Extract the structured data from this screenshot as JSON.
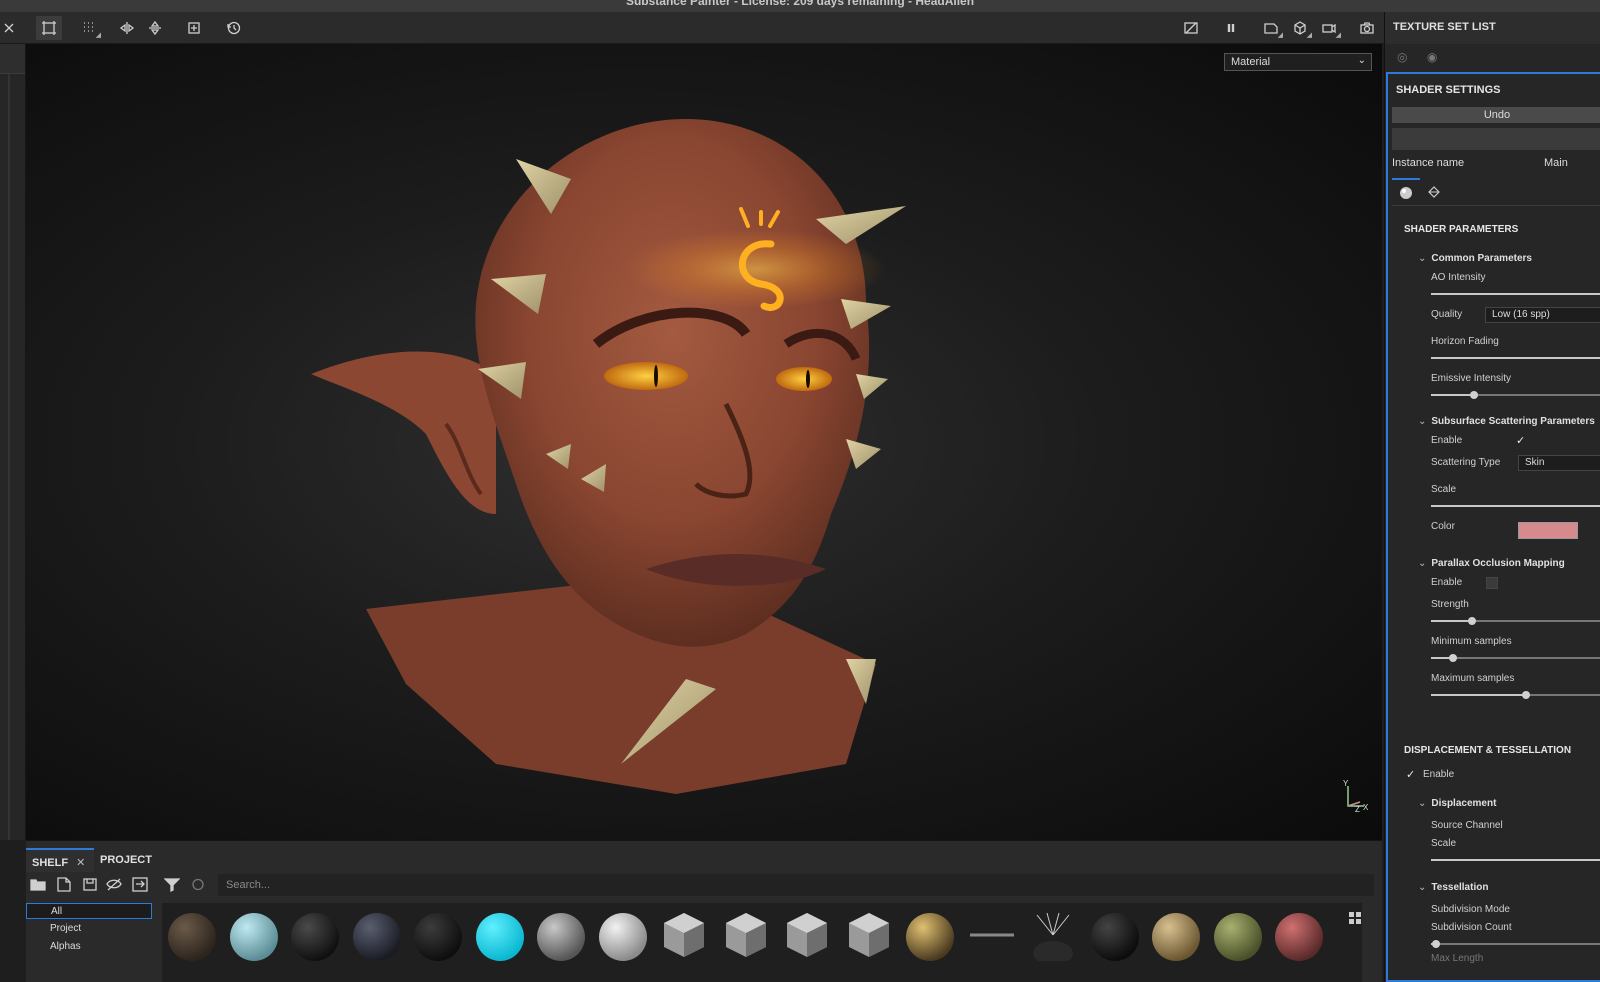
{
  "window": {
    "title": "Substance Painter - License: 209 days remaining - HeadAlien"
  },
  "viewport": {
    "mode_select": "Material",
    "gizmo_axes": [
      "Y",
      "Z",
      "X"
    ]
  },
  "right_panel": {
    "texture_set_title": "TEXTURE SET LIST",
    "shader_settings": {
      "title": "SHADER SETTINGS",
      "undo_label": "Undo",
      "instance_label": "Instance name",
      "instance_value": "Main"
    },
    "shader_parameters": {
      "title": "SHADER PARAMETERS",
      "common": {
        "title": "Common Parameters",
        "ao_intensity_label": "AO Intensity",
        "ao_intensity": 1.0,
        "quality_label": "Quality",
        "quality_value": "Low (16 spp)",
        "horizon_fading_label": "Horizon Fading",
        "horizon_fading": 1.0,
        "emissive_label": "Emissive Intensity",
        "emissive": 0.3
      },
      "sss": {
        "title": "Subsurface Scattering Parameters",
        "enable_label": "Enable",
        "enabled": true,
        "type_label": "Scattering Type",
        "type_value": "Skin",
        "scale_label": "Scale",
        "scale": 1.0,
        "color_label": "Color",
        "color": "#d78a8d"
      },
      "pom": {
        "title": "Parallax Occlusion Mapping",
        "enable_label": "Enable",
        "enabled": false,
        "strength_label": "Strength",
        "strength": 0.3,
        "min_label": "Minimum samples",
        "min_samples": 0.16,
        "max_label": "Maximum samples",
        "max_samples": 0.68
      }
    },
    "displacement": {
      "title": "DISPLACEMENT & TESSELLATION",
      "enable_label": "Enable",
      "enabled": true,
      "displacement_group": "Displacement",
      "source_channel_label": "Source Channel",
      "scale_label": "Scale",
      "scale": 1.0,
      "tessellation_group": "Tessellation",
      "subdiv_mode_label": "Subdivision Mode",
      "subdiv_count_label": "Subdivision Count",
      "subdiv_count": 0.02,
      "max_length_label": "Max Length"
    }
  },
  "shelf": {
    "tab_shelf": "SHELF",
    "tab_project": "PROJECT",
    "close_glyph": "✕",
    "search_placeholder": "Search...",
    "categories": [
      "All",
      "Project",
      "Alphas"
    ],
    "selected_category": "All",
    "thumbnails": [
      "material-ball-leather",
      "material-ball-ice",
      "material-ball-black-pattern",
      "material-ball-dark-metal",
      "material-ball-black",
      "material-ball-cyan",
      "material-ball-grey",
      "material-ball-white",
      "noise-cube-1",
      "noise-cube-2",
      "noise-cube-3",
      "noise-cube-4",
      "fx-ball",
      "line-brush",
      "light-rig",
      "material-ball-rubber",
      "material-ball-tan",
      "material-ball-olive",
      "material-ball-pink"
    ]
  },
  "colors": {
    "accent": "#2d7ad8",
    "glow": "#ffb020",
    "skin": "#8e4a35",
    "horn": "#cbbb8c"
  }
}
